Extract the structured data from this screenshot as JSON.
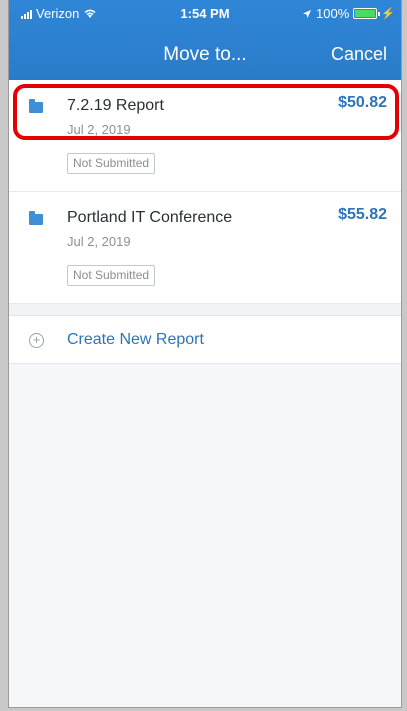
{
  "status_bar": {
    "carrier": "Verizon",
    "time": "1:54 PM",
    "battery": "100%",
    "battery_level": 1.0
  },
  "nav": {
    "title": "Move to...",
    "cancel_label": "Cancel"
  },
  "reports": [
    {
      "name": "7.2.19 Report",
      "date": "Jul 2, 2019",
      "amount": "$50.82",
      "status": "Not Submitted"
    },
    {
      "name": "Portland IT Conference",
      "date": "Jul 2, 2019",
      "amount": "$55.82",
      "status": "Not Submitted"
    }
  ],
  "create_new": {
    "label": "Create New Report"
  },
  "colors": {
    "header": "#2a7cc9",
    "accent": "#2d74b8",
    "highlight": "#e40000"
  },
  "icons": [
    "signal-icon",
    "wifi-icon",
    "location-icon",
    "battery-icon",
    "folder-icon",
    "plus-circle-icon"
  ]
}
